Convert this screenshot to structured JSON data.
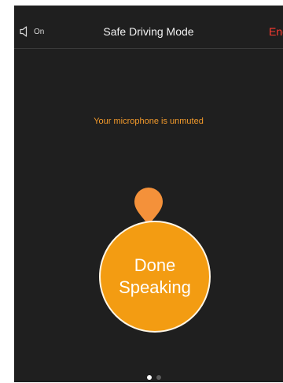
{
  "header": {
    "speaker_label": "On",
    "title": "Safe Driving Mode",
    "end_label": "End"
  },
  "status": {
    "text": "Your microphone is unmuted"
  },
  "main_button": {
    "label": "Done\nSpeaking"
  },
  "pager": {
    "pages": 2,
    "current": 1
  },
  "colors": {
    "background": "#1f1f1f",
    "accent": "#f39c12",
    "end": "#ff3b30"
  }
}
